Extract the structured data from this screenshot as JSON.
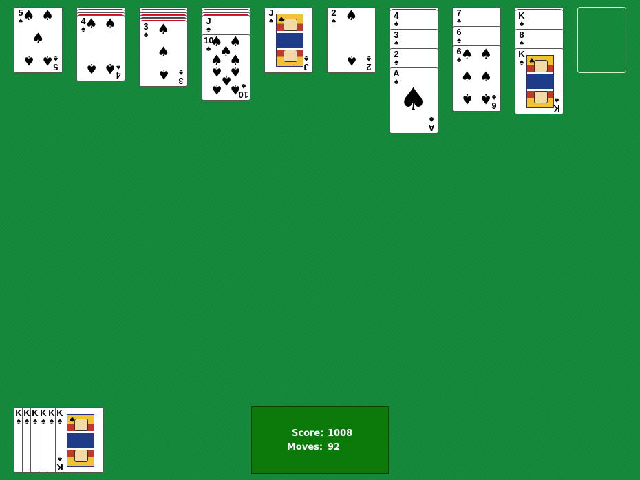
{
  "game": "Spider Solitaire",
  "colors": {
    "felt": "#14893a",
    "card_back": "#c8102e",
    "score_panel": "#0b7a0b"
  },
  "tableau": [
    {
      "hidden_count": 0,
      "cards": [
        {
          "rank": "5",
          "suit": "♠"
        }
      ]
    },
    {
      "hidden_count": 3,
      "cards": [
        {
          "rank": "4",
          "suit": "♠"
        }
      ]
    },
    {
      "hidden_count": 5,
      "cards": [
        {
          "rank": "3",
          "suit": "♠"
        }
      ]
    },
    {
      "hidden_count": 3,
      "cards": [
        {
          "rank": "J",
          "suit": "♠"
        },
        {
          "rank": "10",
          "suit": "♠"
        }
      ]
    },
    {
      "hidden_count": 0,
      "cards": [
        {
          "rank": "J",
          "suit": "♠"
        }
      ]
    },
    {
      "hidden_count": 0,
      "cards": [
        {
          "rank": "2",
          "suit": "♠"
        }
      ]
    },
    {
      "hidden_count": 1,
      "cards": [
        {
          "rank": "4",
          "suit": "♠"
        },
        {
          "rank": "3",
          "suit": "♠"
        },
        {
          "rank": "2",
          "suit": "♠"
        },
        {
          "rank": "A",
          "suit": "♠"
        }
      ]
    },
    {
      "hidden_count": 0,
      "cards": [
        {
          "rank": "7",
          "suit": "♠"
        },
        {
          "rank": "6",
          "suit": "♠"
        },
        {
          "rank": "6",
          "suit": "♠"
        }
      ]
    },
    {
      "hidden_count": 1,
      "cards": [
        {
          "rank": "K",
          "suit": "♠"
        },
        {
          "rank": "8",
          "suit": "♠"
        },
        {
          "rank": "K",
          "suit": "♠"
        }
      ]
    },
    {
      "hidden_count": 0,
      "cards": []
    }
  ],
  "completed_stack": {
    "ranks": [
      "K",
      "K",
      "K",
      "K",
      "K",
      "K"
    ],
    "suit": "♠"
  },
  "score": {
    "score_label": "Score:",
    "score_value": "1008",
    "moves_label": "Moves:",
    "moves_value": "92"
  }
}
